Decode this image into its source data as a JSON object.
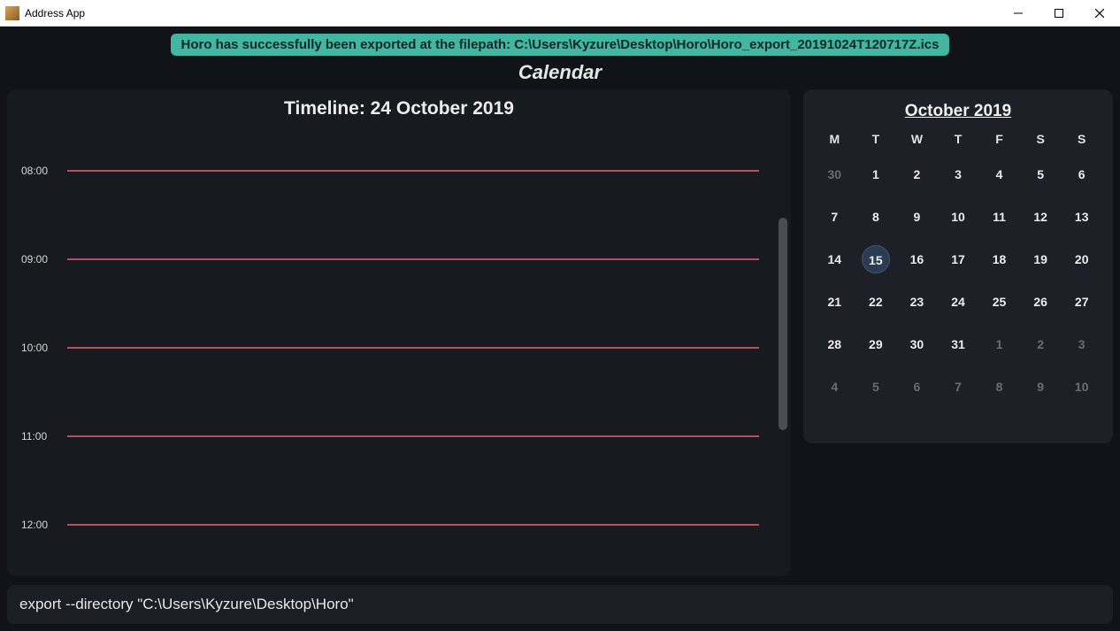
{
  "window": {
    "title": "Address App"
  },
  "notification": {
    "text": "Horo has successfully been exported at the filepath: C:\\Users\\Kyzure\\Desktop\\Horo\\Horo_export_20191024T120717Z.ics"
  },
  "header": {
    "title": "Calendar"
  },
  "timeline": {
    "title": "Timeline: 24 October 2019",
    "hours": [
      "08:00",
      "09:00",
      "10:00",
      "11:00",
      "12:00"
    ]
  },
  "calendar": {
    "month_title": "October 2019",
    "dow": [
      "M",
      "T",
      "W",
      "T",
      "F",
      "S",
      "S"
    ],
    "weeks": [
      [
        {
          "n": "30",
          "other": true
        },
        {
          "n": "1"
        },
        {
          "n": "2"
        },
        {
          "n": "3"
        },
        {
          "n": "4"
        },
        {
          "n": "5"
        },
        {
          "n": "6"
        }
      ],
      [
        {
          "n": "7"
        },
        {
          "n": "8"
        },
        {
          "n": "9"
        },
        {
          "n": "10"
        },
        {
          "n": "11"
        },
        {
          "n": "12"
        },
        {
          "n": "13"
        }
      ],
      [
        {
          "n": "14"
        },
        {
          "n": "15",
          "selected": true
        },
        {
          "n": "16"
        },
        {
          "n": "17"
        },
        {
          "n": "18"
        },
        {
          "n": "19"
        },
        {
          "n": "20"
        }
      ],
      [
        {
          "n": "21"
        },
        {
          "n": "22"
        },
        {
          "n": "23"
        },
        {
          "n": "24"
        },
        {
          "n": "25"
        },
        {
          "n": "26"
        },
        {
          "n": "27"
        }
      ],
      [
        {
          "n": "28"
        },
        {
          "n": "29"
        },
        {
          "n": "30"
        },
        {
          "n": "31"
        },
        {
          "n": "1",
          "other": true
        },
        {
          "n": "2",
          "other": true
        },
        {
          "n": "3",
          "other": true
        }
      ],
      [
        {
          "n": "4",
          "other": true
        },
        {
          "n": "5",
          "other": true
        },
        {
          "n": "6",
          "other": true
        },
        {
          "n": "7",
          "other": true
        },
        {
          "n": "8",
          "other": true
        },
        {
          "n": "9",
          "other": true
        },
        {
          "n": "10",
          "other": true
        }
      ]
    ]
  },
  "command": {
    "value": "export --directory \"C:\\Users\\Kyzure\\Desktop\\Horo\""
  }
}
